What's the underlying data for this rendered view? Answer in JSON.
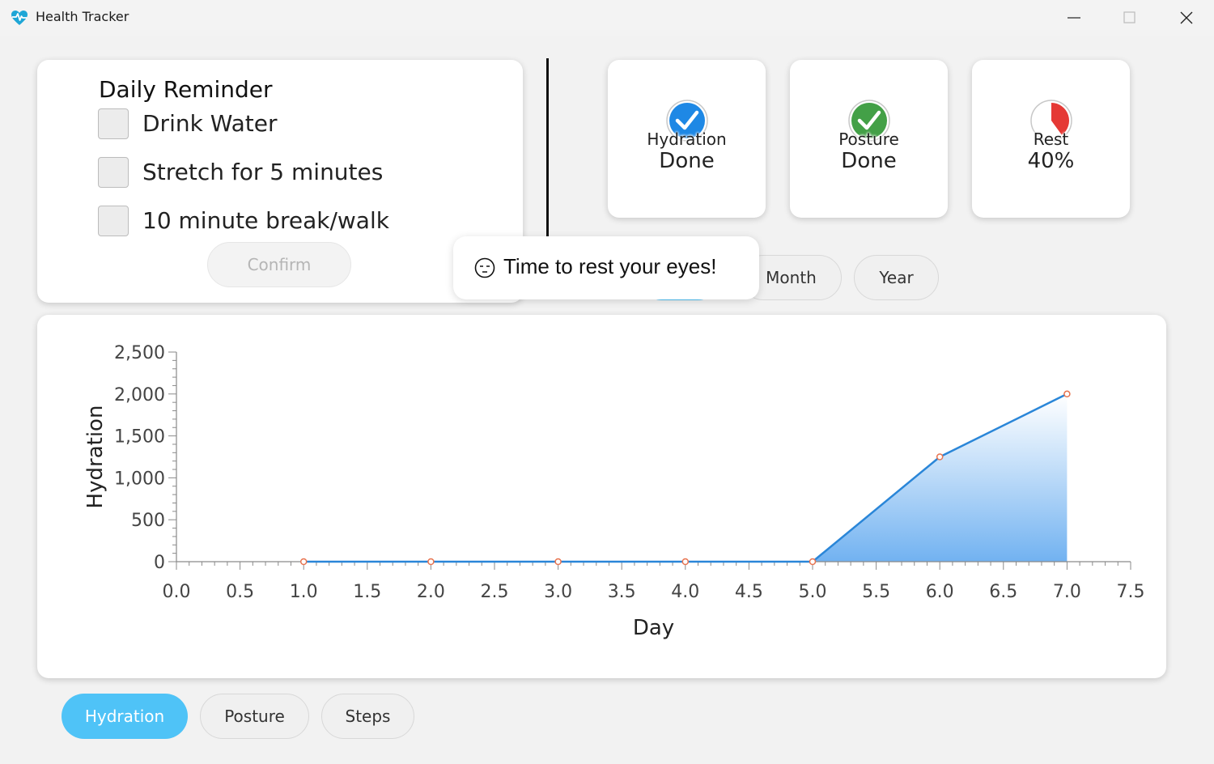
{
  "window": {
    "title": "Health Tracker",
    "icon": "heart-pulse-icon",
    "controls": [
      "minimize-icon",
      "maximize-icon",
      "close-icon"
    ]
  },
  "reminder": {
    "title": "Daily Reminder",
    "items": [
      {
        "label": "Drink Water",
        "checked": false
      },
      {
        "label": "Stretch for 5 minutes",
        "checked": false
      },
      {
        "label": "10 minute break/walk",
        "checked": false
      }
    ],
    "confirm_label": "Confirm",
    "confirm_enabled": false
  },
  "stats": [
    {
      "label": "Hydration",
      "value": "Done",
      "icon": "check-circle-icon",
      "color": "#1e88e5"
    },
    {
      "label": "Posture",
      "value": "Done",
      "icon": "check-circle-icon",
      "color": "#43a047"
    },
    {
      "label": "Rest",
      "value": "40%",
      "icon": "progress-pie-icon",
      "color": "#e53935",
      "progress": 0.4
    }
  ],
  "toast": {
    "text": "Time to rest your eyes!",
    "icon": "sleepy-face-icon"
  },
  "range_tabs": {
    "items": [
      "",
      "Month",
      "Year"
    ],
    "active_index": 0
  },
  "metric_tabs": {
    "items": [
      "Hydration",
      "Posture",
      "Steps"
    ],
    "active_index": 0
  },
  "colors": {
    "accent": "#4fc3f7",
    "line": "#2a86d8",
    "marker": "#e8734f"
  },
  "chart_data": {
    "type": "area",
    "xlabel": "Day",
    "ylabel": "Hydration",
    "xlim": [
      0,
      7.5
    ],
    "ylim": [
      0,
      2500
    ],
    "x_ticks": [
      "0.0",
      "0.5",
      "1.0",
      "1.5",
      "2.0",
      "2.5",
      "3.0",
      "3.5",
      "4.0",
      "4.5",
      "5.0",
      "5.5",
      "6.0",
      "6.5",
      "7.0",
      "7.5"
    ],
    "y_ticks": [
      "0",
      "500",
      "1,000",
      "1,500",
      "2,000",
      "2,500"
    ],
    "grid": false,
    "x": [
      1,
      2,
      3,
      4,
      5,
      6,
      7
    ],
    "y": [
      0,
      0,
      0,
      0,
      0,
      1250,
      2000
    ]
  }
}
